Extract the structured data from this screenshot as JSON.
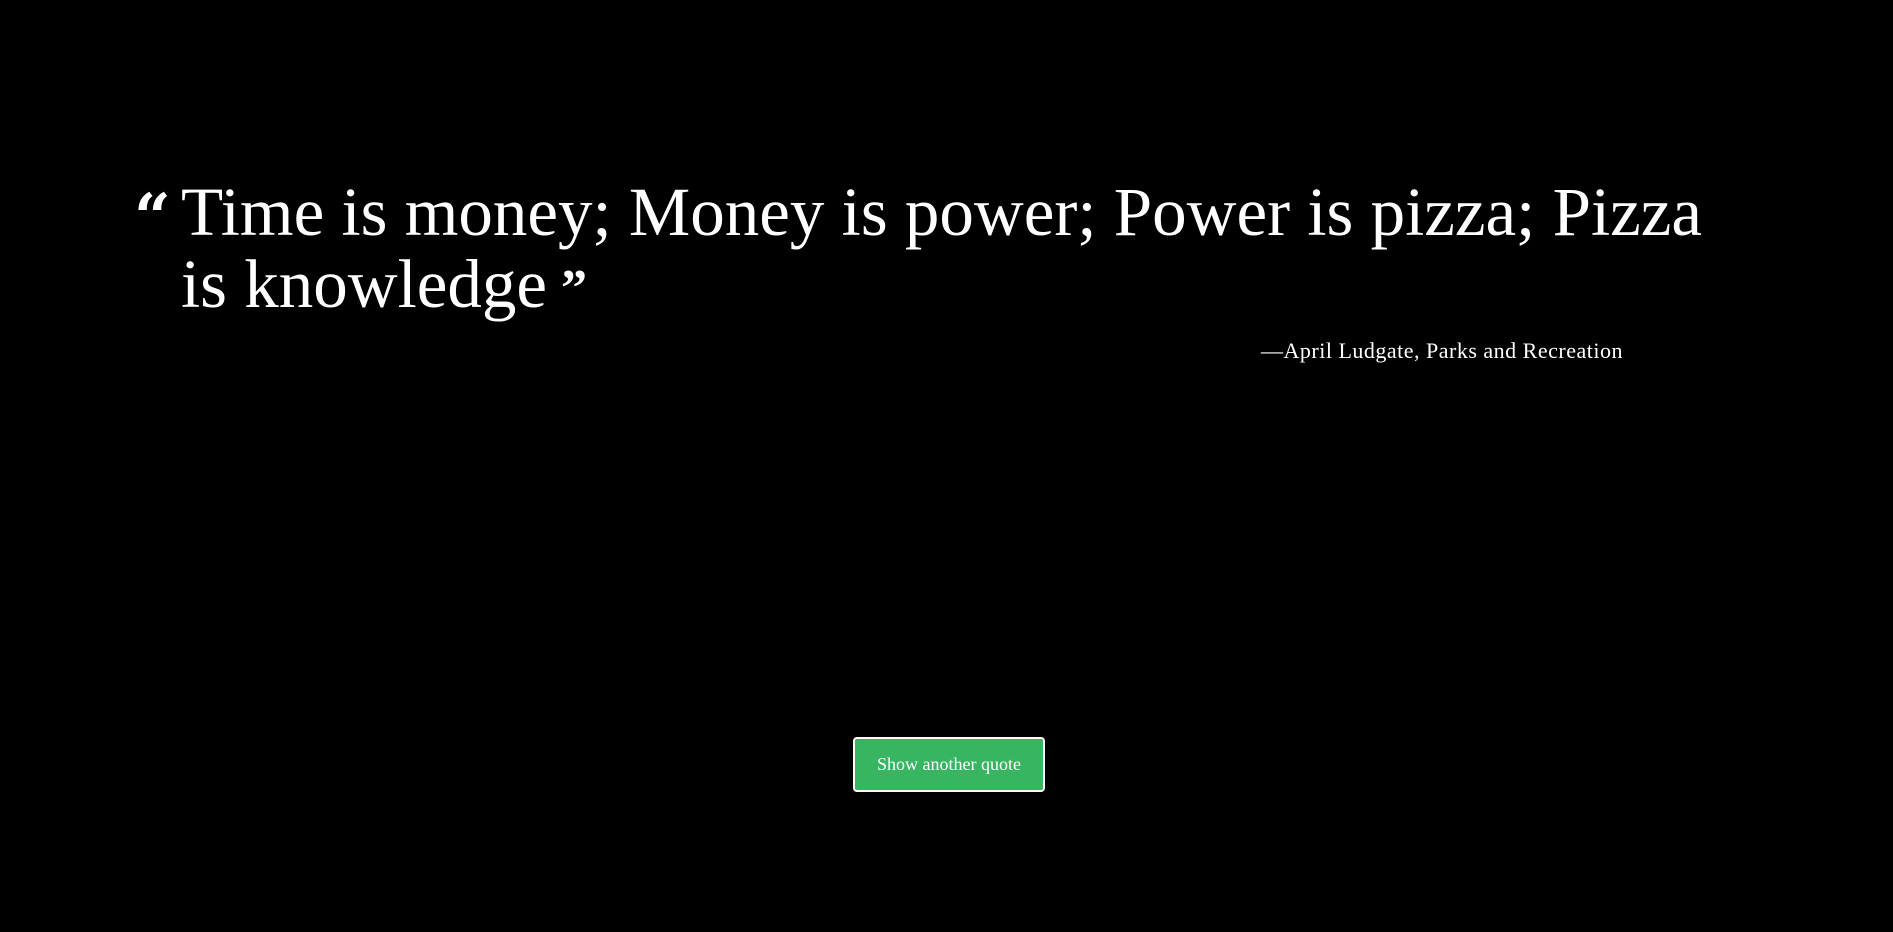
{
  "quote": {
    "text": "Time is money; Money is power; Power is pizza; Pizza is knowledge",
    "open_mark": "“",
    "close_mark": "”",
    "attribution_dash": "—",
    "attribution": "April Ludgate, Parks and Recreation"
  },
  "actions": {
    "new_quote_label": "Show another quote"
  },
  "colors": {
    "background": "#000000",
    "text": "#ffffff",
    "button": "#37b561",
    "button_border": "#ffffff"
  }
}
